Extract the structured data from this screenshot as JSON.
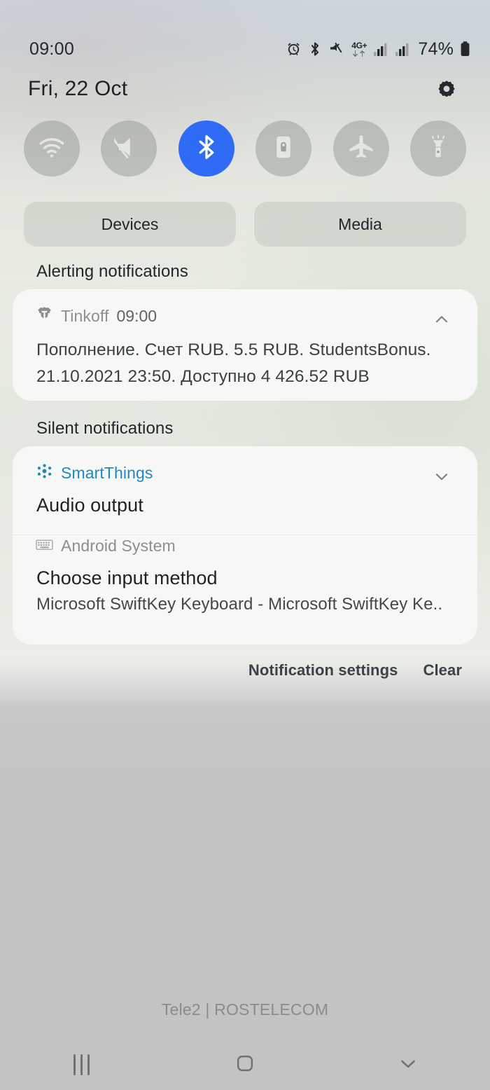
{
  "status_bar": {
    "time": "09:00",
    "battery_percent": "74%",
    "network_type": "4G+",
    "icons": [
      "alarm-icon",
      "bluetooth-icon",
      "mute-icon",
      "network-4gplus-icon",
      "signal-bars-icon-1",
      "signal-bars-icon-2",
      "battery-icon"
    ]
  },
  "header": {
    "date": "Fri, 22 Oct",
    "settings_icon": "gear-icon"
  },
  "quick_settings": {
    "toggles": [
      {
        "name": "wifi",
        "icon": "wifi-icon",
        "active": false
      },
      {
        "name": "sound",
        "icon": "mute-icon",
        "active": false
      },
      {
        "name": "bluetooth",
        "icon": "bluetooth-icon",
        "active": true
      },
      {
        "name": "screen-lock",
        "icon": "rotation-lock-icon",
        "active": false
      },
      {
        "name": "airplane",
        "icon": "airplane-icon",
        "active": false
      },
      {
        "name": "flashlight",
        "icon": "flashlight-icon",
        "active": false
      }
    ],
    "active_color": "#2f6bf4",
    "pills": [
      {
        "label": "Devices"
      },
      {
        "label": "Media"
      }
    ]
  },
  "sections": {
    "alerting_label": "Alerting notifications",
    "silent_label": "Silent notifications"
  },
  "notifications": {
    "alerting": [
      {
        "app": "Tinkoff",
        "app_icon": "tinkoff-icon",
        "time": "09:00",
        "expand_icon": "chevron-up-icon",
        "body_line_1": "Пополнение. Счет RUB. 5.5 RUB. StudentsBonus.",
        "body_line_2": "21.10.2021 23:50. Доступно 4 426.52 RUB"
      }
    ],
    "silent": [
      {
        "app": "SmartThings",
        "app_icon": "smartthings-icon",
        "app_color": "#1f88c4",
        "expand_icon": "chevron-down-icon",
        "title": "Audio output"
      },
      {
        "app": "Android System",
        "app_icon": "keyboard-icon",
        "title": "Choose input method",
        "subtitle": "Microsoft SwiftKey Keyboard - Microsoft SwiftKey Ke.."
      }
    ]
  },
  "footer": {
    "notification_settings_label": "Notification settings",
    "clear_label": "Clear"
  },
  "carrier": "Tele2 | ROSTELECOM",
  "nav_bar": {
    "recents_icon": "recents-icon",
    "home_icon": "home-icon",
    "back_icon": "chevron-down-icon"
  }
}
